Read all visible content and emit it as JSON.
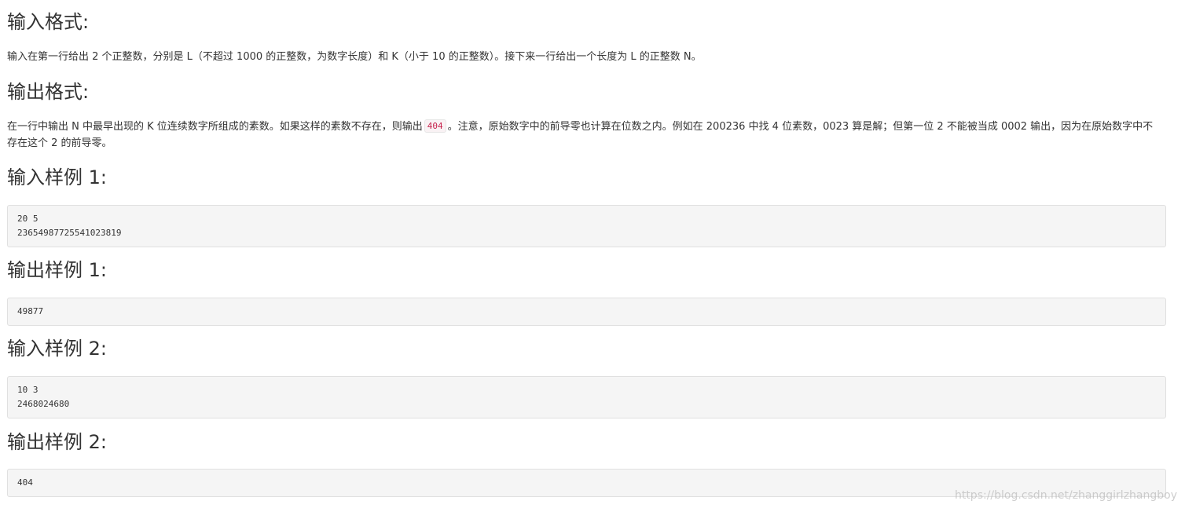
{
  "sections": {
    "input_format": {
      "heading": "输入格式:",
      "text": "输入在第一行给出 2 个正整数，分别是 L（不超过 1000 的正整数，为数字长度）和 K（小于 10 的正整数）。接下来一行给出一个长度为 L 的正整数 N。"
    },
    "output_format": {
      "heading": "输出格式:",
      "text_before": "在一行中输出 N 中最早出现的 K 位连续数字所组成的素数。如果这样的素数不存在，则输出",
      "inline_code": "404",
      "text_after": "。注意，原始数字中的前导零也计算在位数之内。例如在 200236 中找 4 位素数，0023 算是解；但第一位 2 不能被当成 0002 输出，因为在原始数字中不存在这个 2 的前导零。"
    },
    "sample_input_1": {
      "heading": "输入样例 1:",
      "lines": [
        "20 5",
        "23654987725541023819"
      ]
    },
    "sample_output_1": {
      "heading": "输出样例 1:",
      "lines": [
        "49877"
      ]
    },
    "sample_input_2": {
      "heading": "输入样例 2:",
      "lines": [
        "10 3",
        "2468024680"
      ]
    },
    "sample_output_2": {
      "heading": "输出样例 2:",
      "lines": [
        "404"
      ]
    }
  },
  "watermark": "https://blog.csdn.net/zhanggirlzhangboy",
  "colors": {
    "text": "#333333",
    "code_bg": "#f5f5f5",
    "code_border": "#e0e0e0",
    "inline_code_text": "#c7254e"
  }
}
